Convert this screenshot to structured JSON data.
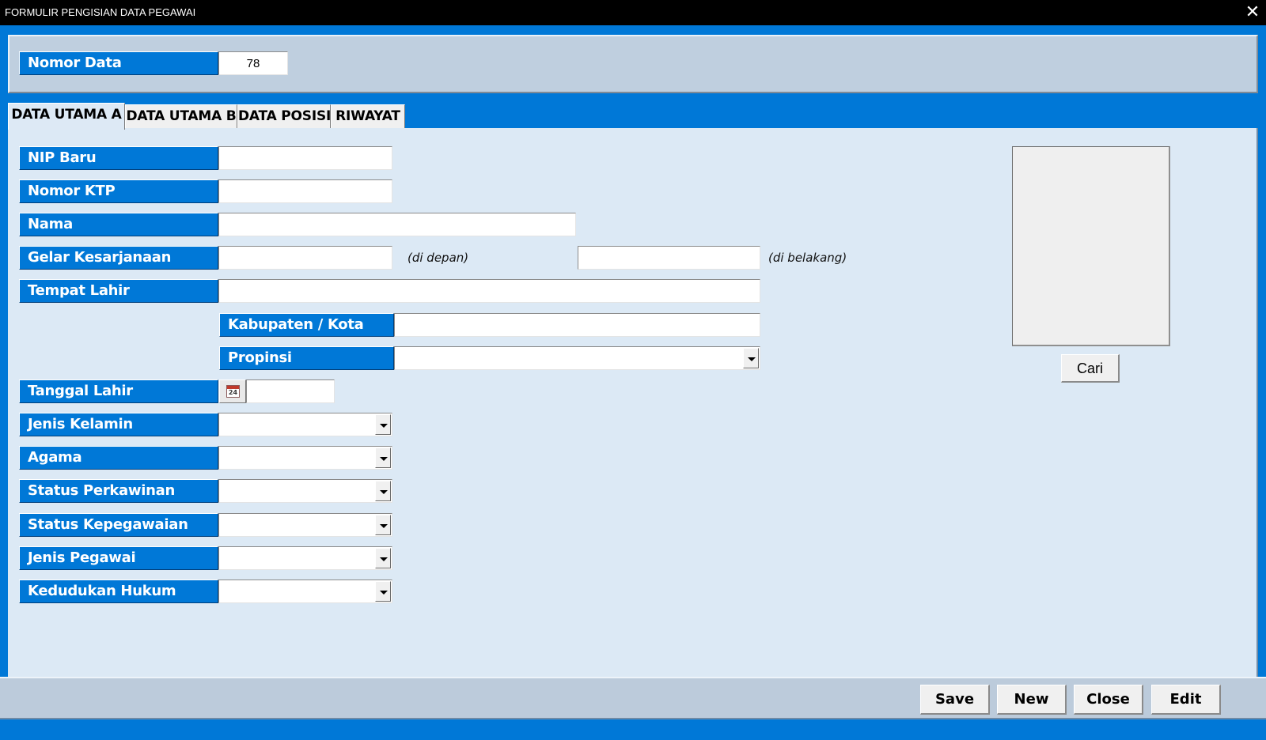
{
  "window": {
    "title": "FORMULIR PENGISIAN DATA PEGAWAI",
    "close_glyph": "✕"
  },
  "header": {
    "nomor_data_label": "Nomor Data",
    "nomor_data_value": "78"
  },
  "tabs": [
    {
      "label": "DATA UTAMA A",
      "active": true
    },
    {
      "label": "DATA UTAMA B",
      "active": false
    },
    {
      "label": "DATA POSISI",
      "active": false
    },
    {
      "label": "RIWAYAT",
      "active": false
    }
  ],
  "form": {
    "nip_baru": {
      "label": "NIP Baru",
      "value": ""
    },
    "nomor_ktp": {
      "label": "Nomor KTP",
      "value": ""
    },
    "nama": {
      "label": "Nama",
      "value": ""
    },
    "gelar": {
      "label": "Gelar Kesarjanaan",
      "depan_value": "",
      "depan_note": "(di depan)",
      "belakang_value": "",
      "belakang_note": "(di belakang)"
    },
    "tempat_lahir": {
      "label": "Tempat Lahir",
      "value": ""
    },
    "kabupaten": {
      "label": "Kabupaten / Kota",
      "value": ""
    },
    "propinsi": {
      "label": "Propinsi",
      "value": ""
    },
    "tanggal_lahir": {
      "label": "Tanggal Lahir",
      "value": "",
      "calendar_day": "24",
      "calendar_icon": "calendar-icon"
    },
    "jenis_kelamin": {
      "label": "Jenis Kelamin",
      "value": ""
    },
    "agama": {
      "label": "Agama",
      "value": ""
    },
    "status_perkawinan": {
      "label": "Status Perkawinan",
      "value": ""
    },
    "status_kepegawaian": {
      "label": "Status Kepegawaian",
      "value": ""
    },
    "jenis_pegawai": {
      "label": "Jenis Pegawai",
      "value": ""
    },
    "kedudukan_hukum": {
      "label": "Kedudukan Hukum",
      "value": ""
    }
  },
  "photo": {
    "cari_label": "Cari"
  },
  "footer": {
    "save_label": "Save",
    "new_label": "New",
    "close_label": "Close",
    "edit_label": "Edit"
  },
  "colors": {
    "accent_blue": "#0078d7",
    "title_bar": "#000000",
    "panel": "#bfcfdf",
    "content_bg": "#dce9f5"
  }
}
